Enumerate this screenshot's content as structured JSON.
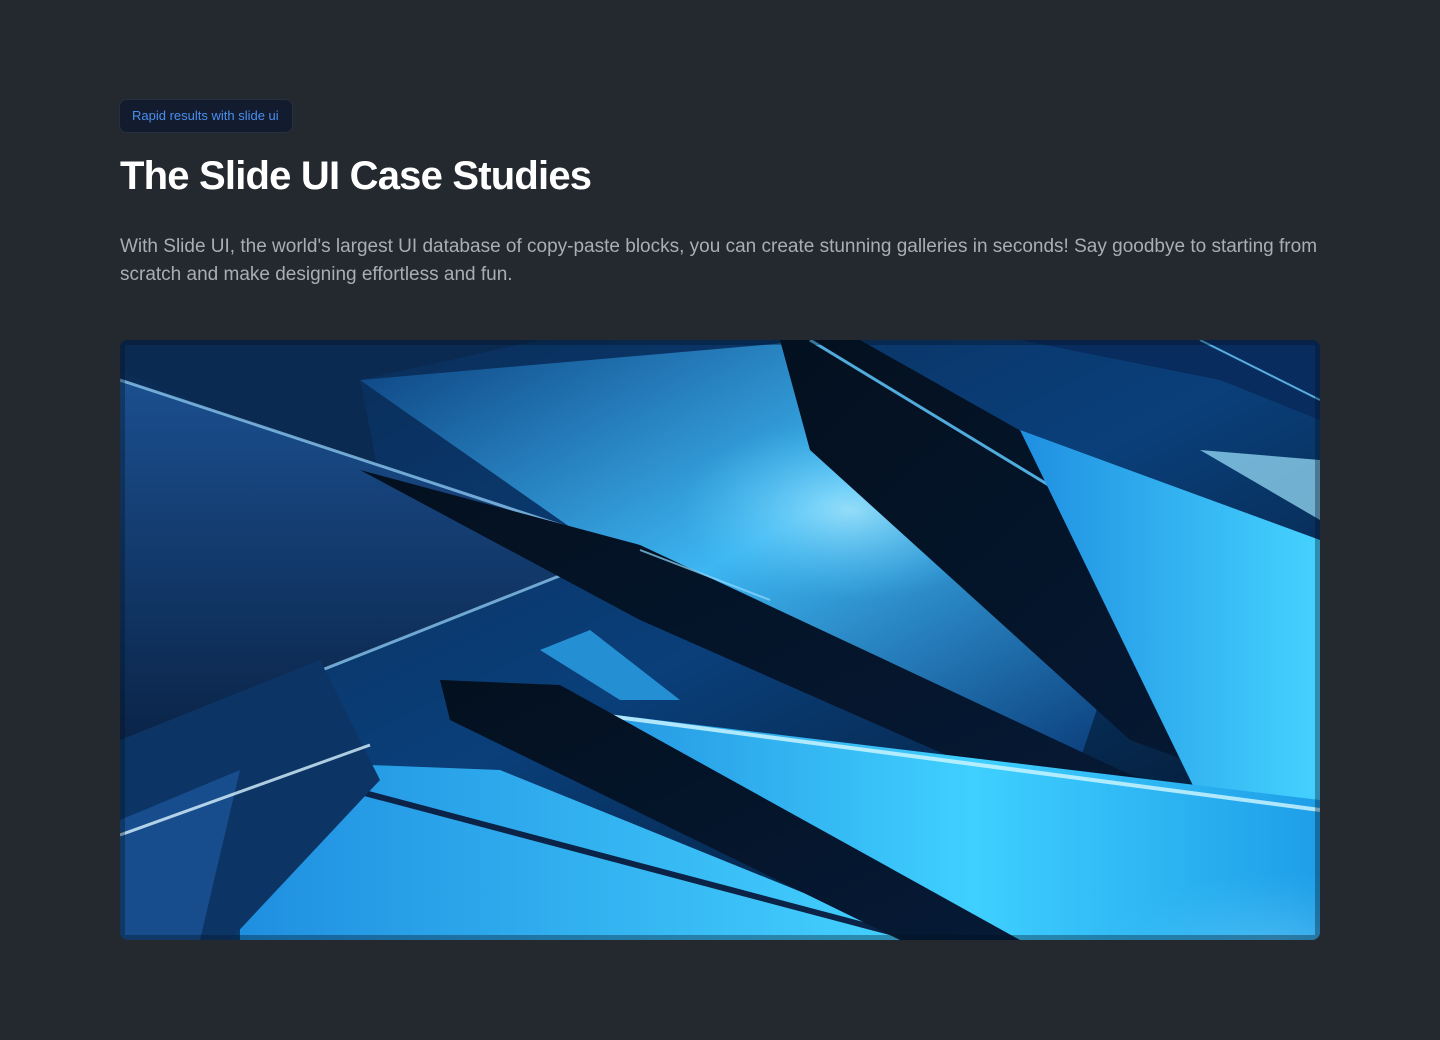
{
  "header": {
    "badge": "Rapid results with slide ui",
    "title": "The Slide UI Case Studies",
    "description": "With Slide UI, the world's largest UI database of copy-paste blocks, you can create stunning galleries in seconds! Say goodbye to starting from scratch and make designing effortless and fun."
  },
  "hero": {
    "image": "abstract-blue-glass-shards",
    "colors": {
      "page_background": "#23292e",
      "badge_background": "#131c2e",
      "badge_text": "#4a8ef0",
      "shard_light": "#35c8ff",
      "shard_dark": "#04142c"
    }
  }
}
